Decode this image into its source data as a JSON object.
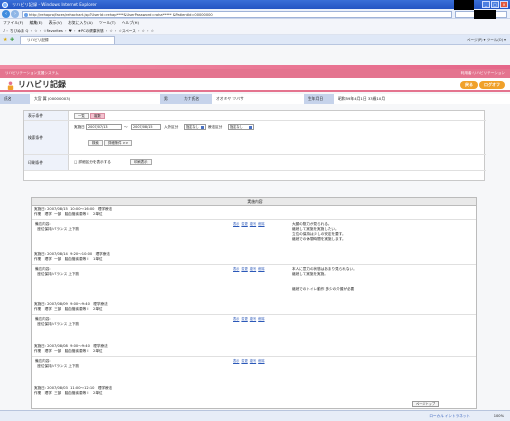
{
  "browser": {
    "title": "リハビリ記録 - Windows Internet Explorer",
    "address": "http://rehapro/faces/rehachart.jsp?UserId=rehap****&UserPassword=raha***** &PatientId=00000000",
    "menu": [
      "ファイル(F)",
      "編集(E)",
      "表示(V)",
      "お気に入り(A)",
      "ツール(T)",
      "ヘルプ(H)"
    ],
    "toolbar_text": "♪・ ちびぬま Q ・ ☆ ・ ☆Favorites ・ ♥ ・ ★PCの健康状態 ・ ☆ ・ ☆スペース ・ ☆ ・ ☆",
    "tab_label": "リハビリ記録",
    "command_bar": "ページ(P) ▾  ツール(O) ▾",
    "status_zone": "ローカル イントラネット",
    "status_zoom": "100%"
  },
  "app": {
    "system_name": "リハビリテーション支援システム",
    "user_line": "利用者:リハビリテーション",
    "title": "リハビリ記録",
    "btn_back": "戻る",
    "btn_logout": "ログオフ",
    "patient": {
      "name_label": "氏名",
      "name_value": "大宮 翼 (00000003)",
      "sex_label": "男",
      "kana_label": "カナ氏名",
      "kana_value": "オオミヤ ツバサ",
      "dob_label": "生年月日",
      "dob_value": "昭和59年4月1日 33歳10月"
    },
    "filter": {
      "display_label": "表示条件",
      "btn_list": "一覧",
      "btn_detail": "複数",
      "search_label": "検索条件",
      "date_label": "実施日",
      "date_from": "2007/07/13",
      "date_sep": "～",
      "date_to": "2007/08/15",
      "in_label": "入外区分",
      "in_value": "指定なし",
      "staff_label": "療法区分",
      "staff_value": "指定なし",
      "btn_search": "検索",
      "btn_clear": "詳細条件 >>",
      "print_label": "印刷条件",
      "print_text": "□ 詳細区分を表示する",
      "btn_print": "印刷表示"
    },
    "list": {
      "header": "実施内容",
      "records": [
        {
          "meta": "実施日: 2007/08/15  10:00～16:00   理学療法\n作業   理学  一部   脳血管疾患等 I    2単位",
          "body": "備忘内容:\n  座位保持/バランス 上下肢",
          "acts": [
            "表示",
            "変更",
            "複写",
            "削除"
          ],
          "note": "大腿の筋力が見られる。\n継続して実施を実施したい。\n立位の保持は少しの安定を要す。\n継続での休憩時間を実施します。"
        },
        {
          "meta": "実施日: 2007/08/14  9:20～10:00   理学療法\n作業   理学  一部   脳血管疾患等 I    1単位",
          "body": "備忘内容:\n  座位保持/バランス 上下肢",
          "acts": [
            "表示",
            "変更",
            "複写",
            "削除"
          ],
          "note": "本人に意力の状態はあまり見られない。\n継続して実施を実施。\n\n\n継続でのトイレ動作 多少の介護が必要"
        },
        {
          "meta": "実施日: 2007/08/09  9:00～9:40   理学療法\n作業   理学  三部   脳血管疾患等 I    2単位",
          "body": "備忘内容:\n  座位保持/バランス 上下肢",
          "acts": [
            "表示",
            "変更",
            "複写",
            "削除"
          ],
          "note": ""
        },
        {
          "meta": "実施日: 2007/08/08  9:00～9:40   理学療法\n作業   理学  一部   脳血管疾患等 I    2単位",
          "body": "備忘内容:\n  座位保持/バランス 上下肢",
          "acts": [
            "表示",
            "変更",
            "複写",
            "削除"
          ],
          "note": ""
        },
        {
          "meta": "実施日: 2007/08/03  11:00～12:10   理学療法\n作業   理学  三部   脳血管疾患等 I    2単位",
          "body": "",
          "acts": [],
          "note": ""
        }
      ],
      "btn_top": "ページトップ"
    }
  }
}
